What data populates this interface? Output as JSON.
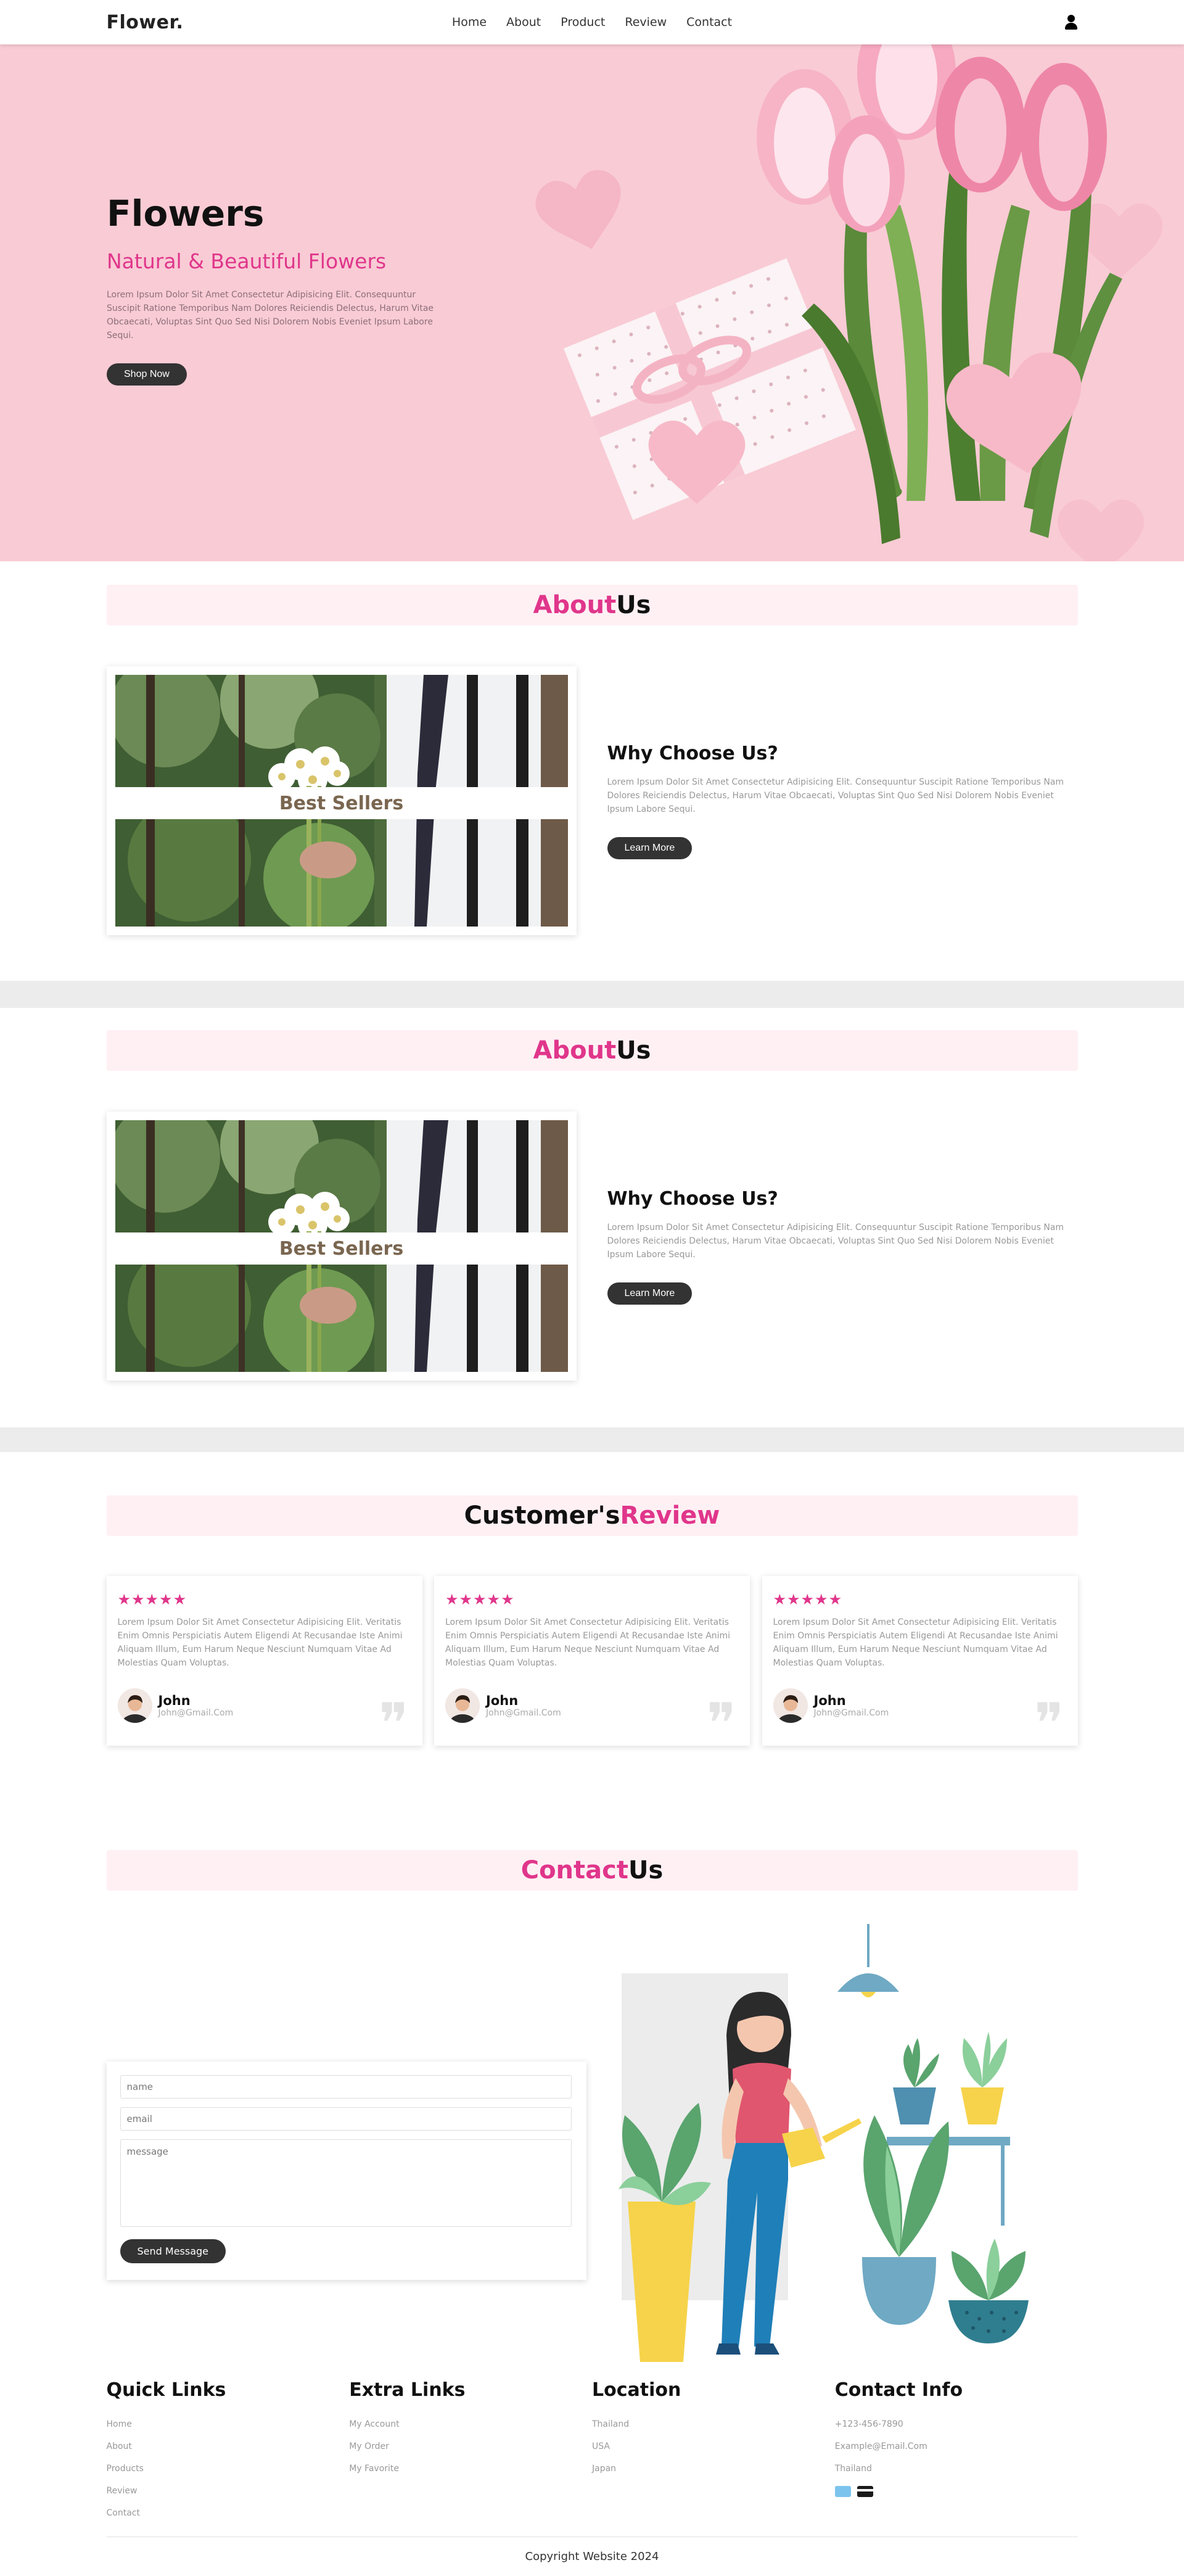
{
  "nav": {
    "logo": "Flower.",
    "links": [
      "Home",
      "About",
      "Product",
      "Review",
      "Contact"
    ],
    "user_icon": "user-icon"
  },
  "hero": {
    "title": "Flowers",
    "subtitle": "Natural & Beautiful Flowers",
    "description": "Lorem Ipsum Dolor Sit Amet Consectetur Adipisicing Elit. Consequuntur Suscipit Ratione Temporibus Nam Dolores Reiciendis Delectus, Harum Vitae Obcaecati, Voluptas Sint Quo Sed Nisi Dolorem Nobis Eveniet Ipsum Labore Sequi.",
    "button": "Shop Now"
  },
  "about": {
    "title_pink": "About",
    "title_rest": " Us",
    "image_caption": "Best Sellers",
    "heading": "Why Choose Us?",
    "text": "Lorem Ipsum Dolor Sit Amet Consectetur Adipisicing Elit. Consequuntur Suscipit Ratione Temporibus Nam Dolores Reiciendis Delectus, Harum Vitae Obcaecati, Voluptas Sint Quo Sed Nisi Dolorem Nobis Eveniet Ipsum Labore Sequi.",
    "button": "Learn More"
  },
  "review": {
    "title_rest": "Customer's ",
    "title_pink": "Review",
    "cards": [
      {
        "stars": "★★★★★",
        "text": "Lorem Ipsum Dolor Sit Amet Consectetur Adipisicing Elit. Veritatis Enim Omnis Perspiciatis Autem Eligendi At Recusandae Iste Animi Aliquam Illum, Eum Harum Neque Nesciunt Numquam Vitae Ad Molestias Quam Voluptas.",
        "name": "John",
        "email": "John@Gmail.Com"
      },
      {
        "stars": "★★★★★",
        "text": "Lorem Ipsum Dolor Sit Amet Consectetur Adipisicing Elit. Veritatis Enim Omnis Perspiciatis Autem Eligendi At Recusandae Iste Animi Aliquam Illum, Eum Harum Neque Nesciunt Numquam Vitae Ad Molestias Quam Voluptas.",
        "name": "John",
        "email": "John@Gmail.Com"
      },
      {
        "stars": "★★★★★",
        "text": "Lorem Ipsum Dolor Sit Amet Consectetur Adipisicing Elit. Veritatis Enim Omnis Perspiciatis Autem Eligendi At Recusandae Iste Animi Aliquam Illum, Eum Harum Neque Nesciunt Numquam Vitae Ad Molestias Quam Voluptas.",
        "name": "John",
        "email": "John@Gmail.Com"
      }
    ],
    "quote_glyph": "❞"
  },
  "contact": {
    "title_pink": "Contact",
    "title_rest": " Us",
    "placeholder_name": "name",
    "placeholder_email": "email",
    "placeholder_message": "message",
    "button": "Send Message"
  },
  "footer": {
    "cols": [
      {
        "heading": "Quick Links",
        "links": [
          "Home",
          "About",
          "Products",
          "Review",
          "Contact"
        ]
      },
      {
        "heading": "Extra Links",
        "links": [
          "My Account",
          "My Order",
          "My Favorite"
        ]
      },
      {
        "heading": "Location",
        "links": [
          "Thailand",
          "USA",
          "Japan"
        ]
      },
      {
        "heading": "Contact Info",
        "links": [
          "+123-456-7890",
          "Example@Email.Com",
          "Thailand"
        ]
      }
    ],
    "copyright": "Copyright Website 2024"
  },
  "colors": {
    "accent": "#e0368b",
    "hero_bg": "#f9cbd5",
    "title_band": "#fff0f4",
    "dark_button": "#333333"
  }
}
